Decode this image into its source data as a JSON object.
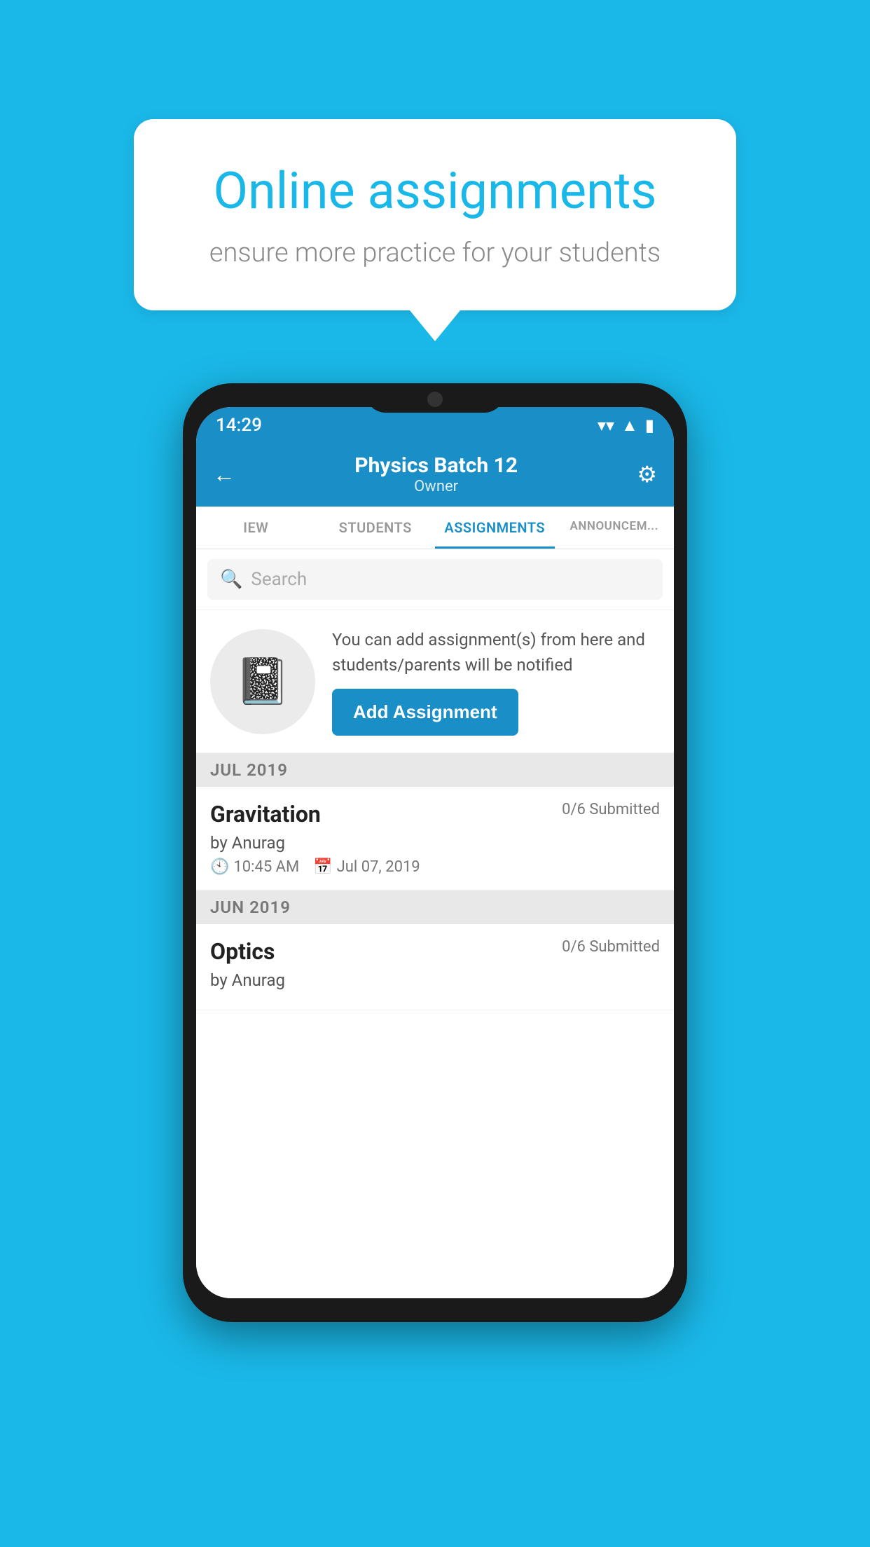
{
  "background_color": "#1ab8e8",
  "speech_bubble": {
    "title": "Online assignments",
    "subtitle": "ensure more practice for your students"
  },
  "status_bar": {
    "time": "14:29",
    "wifi_icon": "▲",
    "signal_icon": "◀",
    "battery_icon": "▮"
  },
  "app_header": {
    "back_label": "←",
    "title": "Physics Batch 12",
    "subtitle": "Owner",
    "settings_icon": "⚙"
  },
  "tabs": [
    {
      "label": "IEW",
      "active": false
    },
    {
      "label": "STUDENTS",
      "active": false
    },
    {
      "label": "ASSIGNMENTS",
      "active": true
    },
    {
      "label": "ANNOUNCEM...",
      "active": false
    }
  ],
  "search": {
    "placeholder": "Search"
  },
  "add_assignment_promo": {
    "description": "You can add assignment(s) from here and students/parents will be notified",
    "button_label": "Add Assignment"
  },
  "assignment_sections": [
    {
      "month": "JUL 2019",
      "assignments": [
        {
          "name": "Gravitation",
          "submitted": "0/6 Submitted",
          "by": "by Anurag",
          "time": "10:45 AM",
          "date": "Jul 07, 2019"
        }
      ]
    },
    {
      "month": "JUN 2019",
      "assignments": [
        {
          "name": "Optics",
          "submitted": "0/6 Submitted",
          "by": "by Anurag",
          "time": "",
          "date": ""
        }
      ]
    }
  ]
}
